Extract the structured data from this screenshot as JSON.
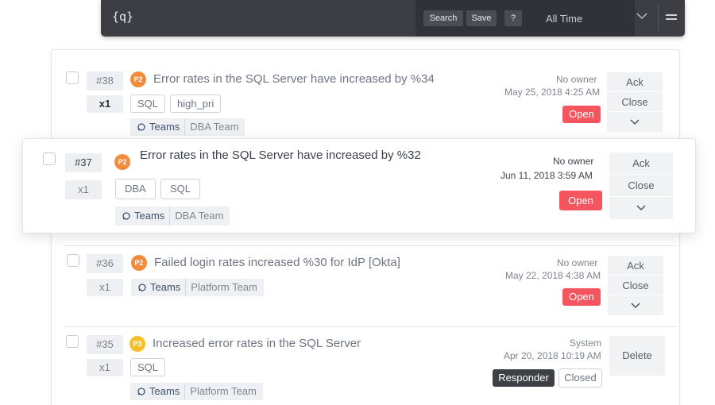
{
  "topbar": {
    "query_icon": "{q}",
    "search_label": "Search",
    "save_label": "Save",
    "help_label": "?",
    "time_range": "All Time",
    "chevron_icon": "chevron-down-icon",
    "menu_icon": "hamburger-icon"
  },
  "alerts": [
    {
      "id": "#38",
      "count": "x1",
      "priority": "P2",
      "title": "Error rates in the SQL Server have increased by %34",
      "tags": [
        "SQL",
        "high_pri"
      ],
      "team_key": "Teams",
      "team_value": "DBA Team",
      "owner": "No owner",
      "date": "May 25, 2018 4:25 AM",
      "status": "Open",
      "actions": [
        "Ack",
        "Close",
        "⌄"
      ]
    },
    {
      "id": "#37",
      "count": "x1",
      "priority": "P2",
      "title": "Error rates in the SQL Server have increased by %32",
      "tags": [
        "DBA",
        "SQL"
      ],
      "team_key": "Teams",
      "team_value": "DBA Team",
      "owner": "No owner",
      "date": "Jun 11, 2018 3:59 AM",
      "status": "Open",
      "actions": [
        "Ack",
        "Close",
        "⌄"
      ]
    },
    {
      "id": "#36",
      "count": "x1",
      "priority": "P2",
      "title": "Failed login rates increased %30 for IdP [Okta]",
      "tags": [],
      "team_key": "Teams",
      "team_value": "Platform Team",
      "owner": "No owner",
      "date": "May 22, 2018 4:38 AM",
      "status": "Open",
      "actions": [
        "Ack",
        "Close",
        "⌄"
      ]
    },
    {
      "id": "#35",
      "count": "x1",
      "priority": "P3",
      "title": "Increased error rates in the SQL Server",
      "tags": [
        "SQL"
      ],
      "team_key": "Teams",
      "team_value": "Platform Team",
      "owner": "System",
      "date": "Apr 20, 2018 10:19 AM",
      "status_responder": "Responder",
      "status": "Closed",
      "actions": [
        "Delete"
      ]
    }
  ],
  "colors": {
    "topbar_bg": "#3c3e43",
    "p2": "#f28c3c",
    "p3": "#f4bf28",
    "open": "#f5555f",
    "responder": "#3e4046"
  }
}
